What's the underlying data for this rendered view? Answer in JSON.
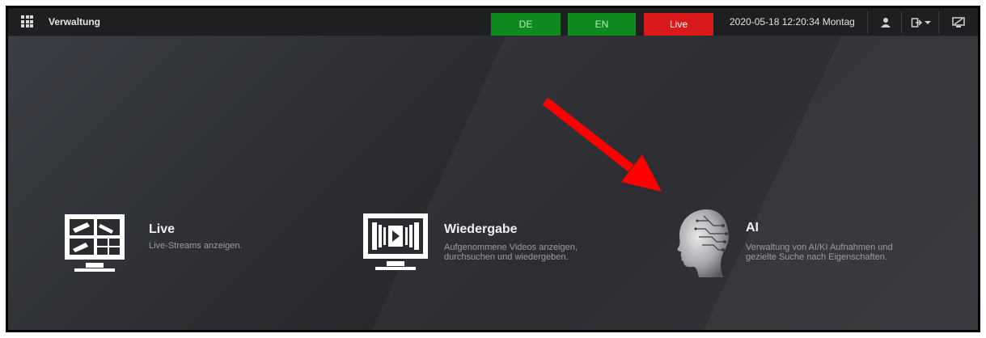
{
  "header": {
    "title": "Verwaltung",
    "lang_de": "DE",
    "lang_en": "EN",
    "live_label": "Live",
    "datetime": "2020-05-18 12:20:34 Montag"
  },
  "icons": {
    "menu": "grid-menu-icon",
    "user": "user-icon",
    "logout": "logout-icon",
    "dropdown": "chevron-down-icon",
    "display": "monitor-icon"
  },
  "colors": {
    "lang_green": "#0e8a1e",
    "live_red": "#d9191b",
    "arrow_red": "#ff0000"
  },
  "tiles": [
    {
      "title": "Live",
      "desc_line1": "Live-Streams anzeigen.",
      "desc_line2": "",
      "icon": "live-monitor-icon"
    },
    {
      "title": "Wiedergabe",
      "desc_line1": "Aufgenommene Videos anzeigen,",
      "desc_line2": "durchsuchen und wiedergeben.",
      "icon": "playback-monitor-icon"
    },
    {
      "title": "AI",
      "desc_line1": "Verwaltung von AI/KI Aufnahmen und",
      "desc_line2": "gezielte Suche nach Eigenschaften.",
      "icon": "ai-head-icon"
    }
  ]
}
